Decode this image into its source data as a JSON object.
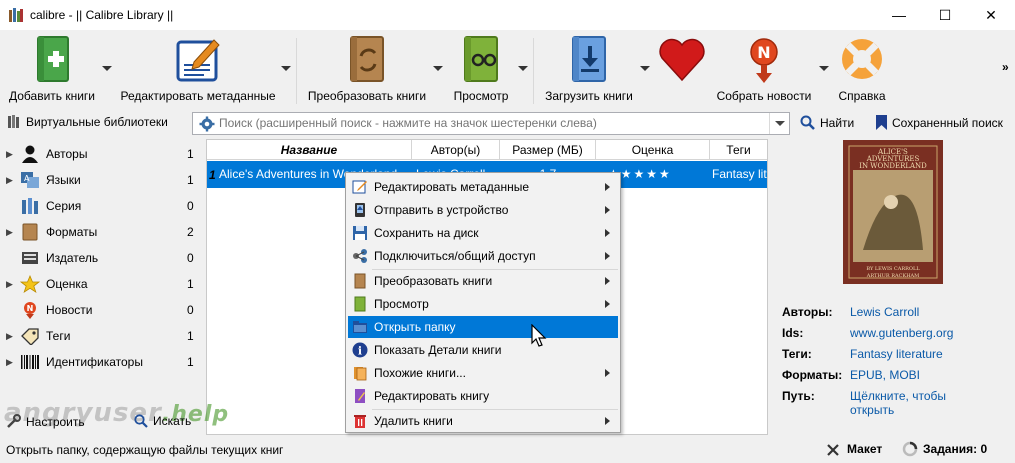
{
  "window": {
    "title": "calibre - || Calibre Library ||",
    "minimize": "—",
    "maximize": "☐",
    "close": "✕"
  },
  "toolbar": {
    "add_books": "Добавить книги",
    "edit_metadata": "Редактировать метаданные",
    "convert_books": "Преобразовать книги",
    "view": "Просмотр",
    "download_books": "Загрузить книги",
    "donate_icon": "heart-icon",
    "fetch_news": "Собрать новости",
    "help": "Справка",
    "more": "»"
  },
  "search": {
    "virtual_libraries": "Виртуальные библиотеки",
    "placeholder": "Поиск (расширенный поиск - нажмите на значок шестеренки слева)",
    "find": "Найти",
    "saved_search": "Сохраненный поиск"
  },
  "tag_browser": {
    "items": [
      {
        "label": "Авторы",
        "count": "1",
        "icon": "person-icon"
      },
      {
        "label": "Языки",
        "count": "1",
        "icon": "language-icon"
      },
      {
        "label": "Серия",
        "count": "0",
        "icon": "series-icon"
      },
      {
        "label": "Форматы",
        "count": "2",
        "icon": "format-icon"
      },
      {
        "label": "Издатель",
        "count": "0",
        "icon": "publisher-icon"
      },
      {
        "label": "Оценка",
        "count": "1",
        "icon": "star-icon"
      },
      {
        "label": "Новости",
        "count": "0",
        "icon": "news-icon"
      },
      {
        "label": "Теги",
        "count": "1",
        "icon": "tag-icon"
      },
      {
        "label": "Идентификаторы",
        "count": "1",
        "icon": "barcode-icon"
      }
    ],
    "configure": "Настроить",
    "find": "Искать"
  },
  "table": {
    "columns": [
      "Название",
      "Автор(ы)",
      "Размер (МБ)",
      "Оценка",
      "Теги"
    ],
    "rows": [
      {
        "num": "1",
        "title": "Alice's Adventures in Wonderland",
        "author": "Lewis Carroll",
        "size": "1.7",
        "rating": "★★★★★",
        "tags": "Fantasy literature"
      }
    ]
  },
  "context_menu": {
    "items": [
      {
        "label": "Редактировать метаданные",
        "submenu": true
      },
      {
        "label": "Отправить в устройство",
        "submenu": true
      },
      {
        "label": "Сохранить на диск",
        "submenu": true
      },
      {
        "label": "Подключиться/общий доступ",
        "submenu": true
      },
      {
        "label": "Преобразовать книги",
        "submenu": true
      },
      {
        "label": "Просмотр",
        "submenu": true
      },
      {
        "label": "Открыть папку",
        "submenu": false
      },
      {
        "label": "Показать Детали книги",
        "submenu": false
      },
      {
        "label": "Похожие книги...",
        "submenu": true
      },
      {
        "label": "Редактировать книгу",
        "submenu": false
      },
      {
        "label": "Удалить книги",
        "submenu": true
      }
    ],
    "selected": "Открыть папку"
  },
  "details": {
    "cover_title": "ALICE'S ADVENTURES IN WONDERLAND",
    "cover_author": "BY LEWIS CARROLL",
    "cover_illustrator": "ARTHUR RACKHAM",
    "authors_label": "Авторы:",
    "authors_value": "Lewis Carroll",
    "ids_label": "Ids:",
    "ids_value": "www.gutenberg.org",
    "tags_label": "Теги:",
    "tags_value": "Fantasy literature",
    "formats_label": "Форматы:",
    "formats_value": "EPUB, MOBI",
    "path_label": "Путь:",
    "path_value_1": "Щёлкните, чтобы",
    "path_value_2": "открыть"
  },
  "statusbar": {
    "message": "Открыть папку, содержащую файлы текущих книг",
    "layout": "Макет",
    "jobs": "Задания: 0"
  },
  "watermark": {
    "text": "angryuser",
    "suffix": ".help"
  }
}
